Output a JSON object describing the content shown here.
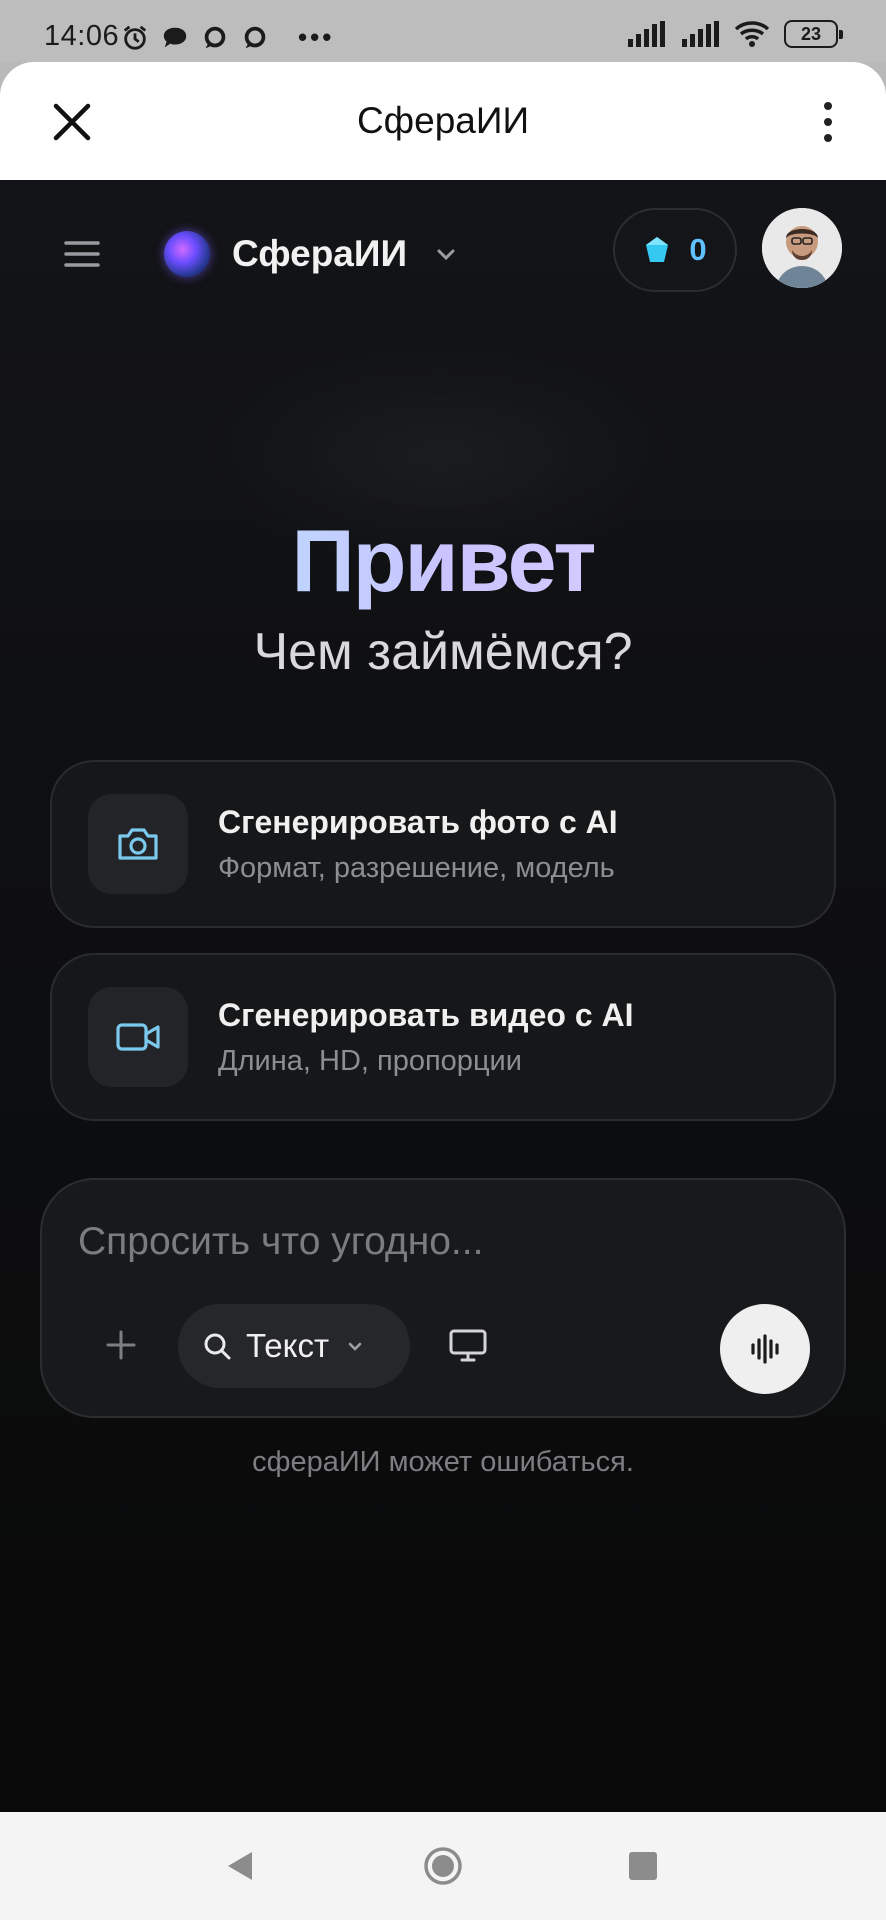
{
  "status_bar": {
    "time": "14:06",
    "battery": "23"
  },
  "browser_sheet": {
    "title": "СфераИИ"
  },
  "app_header": {
    "brand_name": "СфераИИ",
    "credits": "0"
  },
  "hero": {
    "greeting": "Привет",
    "subtitle": "Чем займёмся?"
  },
  "action_cards": [
    {
      "title": "Сгенерировать фото с AI",
      "description": "Формат, разрешение, модель",
      "icon": "camera-icon"
    },
    {
      "title": "Сгенерировать видео с AI",
      "description": "Длина, HD, пропорции",
      "icon": "video-camera-icon"
    }
  ],
  "composer": {
    "placeholder": "Спросить что угодно...",
    "mode_label": "Текст"
  },
  "disclaimer": "сфераИИ может ошибаться.",
  "colors": {
    "accent_cyan": "#5fc2ff",
    "background": "#0e0f11",
    "greeting_gradient_start": "#aef3ff",
    "greeting_gradient_end": "#e6d7ff"
  }
}
